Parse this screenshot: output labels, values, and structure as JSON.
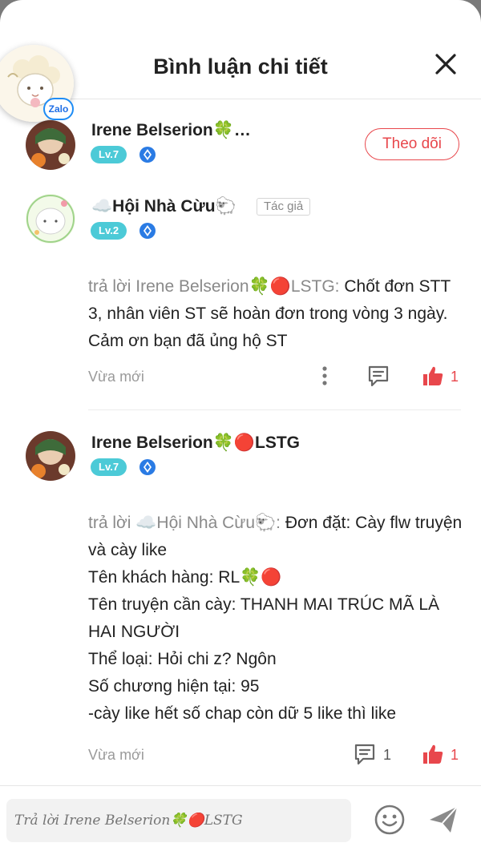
{
  "header": {
    "title": "Bình luận chi tiết",
    "close_icon": "close-icon"
  },
  "zalo_bubble": {
    "badge": "Zalo"
  },
  "comments": [
    {
      "user": "Irene Belserion🍀…",
      "level": "Lv.7",
      "follow_label": "Theo dõi"
    },
    {
      "user": "☁️Hội Nhà Cừu🐑",
      "level": "Lv.2",
      "author_tag": "Tác giả",
      "reply_prefix": "trả lời Irene Belserion🍀🔴LSTG:",
      "text": " Chốt đơn STT 3, nhân viên ST sẽ hoàn đơn trong vòng 3 ngày. Cảm ơn bạn đã ủng hộ ST",
      "time": "Vừa mới",
      "likes": "1"
    },
    {
      "user": "Irene Belserion🍀🔴LSTG",
      "level": "Lv.7",
      "reply_prefix": "trả lời ☁️Hội Nhà Cừu🐑:",
      "text_lines": [
        " Đơn đặt: Cày flw truyện và cày like",
        "Tên khách hàng: RL🍀🔴",
        "Tên truyện cần cày: THANH MAI TRÚC MÃ LÀ HAI NGƯỜI",
        "Thể loại: Hỏi chi z? Ngôn",
        "Số chương hiện tại: 95",
        "-cày like hết số chap còn dữ 5 like thì like"
      ],
      "time": "Vừa mới",
      "replies": "1",
      "likes": "1"
    }
  ],
  "footer": {
    "placeholder": "Trả lời Irene Belserion🍀🔴LSTG"
  },
  "colors": {
    "accent": "#e8474c",
    "level_badge": "#4ccad7",
    "divider": "#ececec"
  }
}
